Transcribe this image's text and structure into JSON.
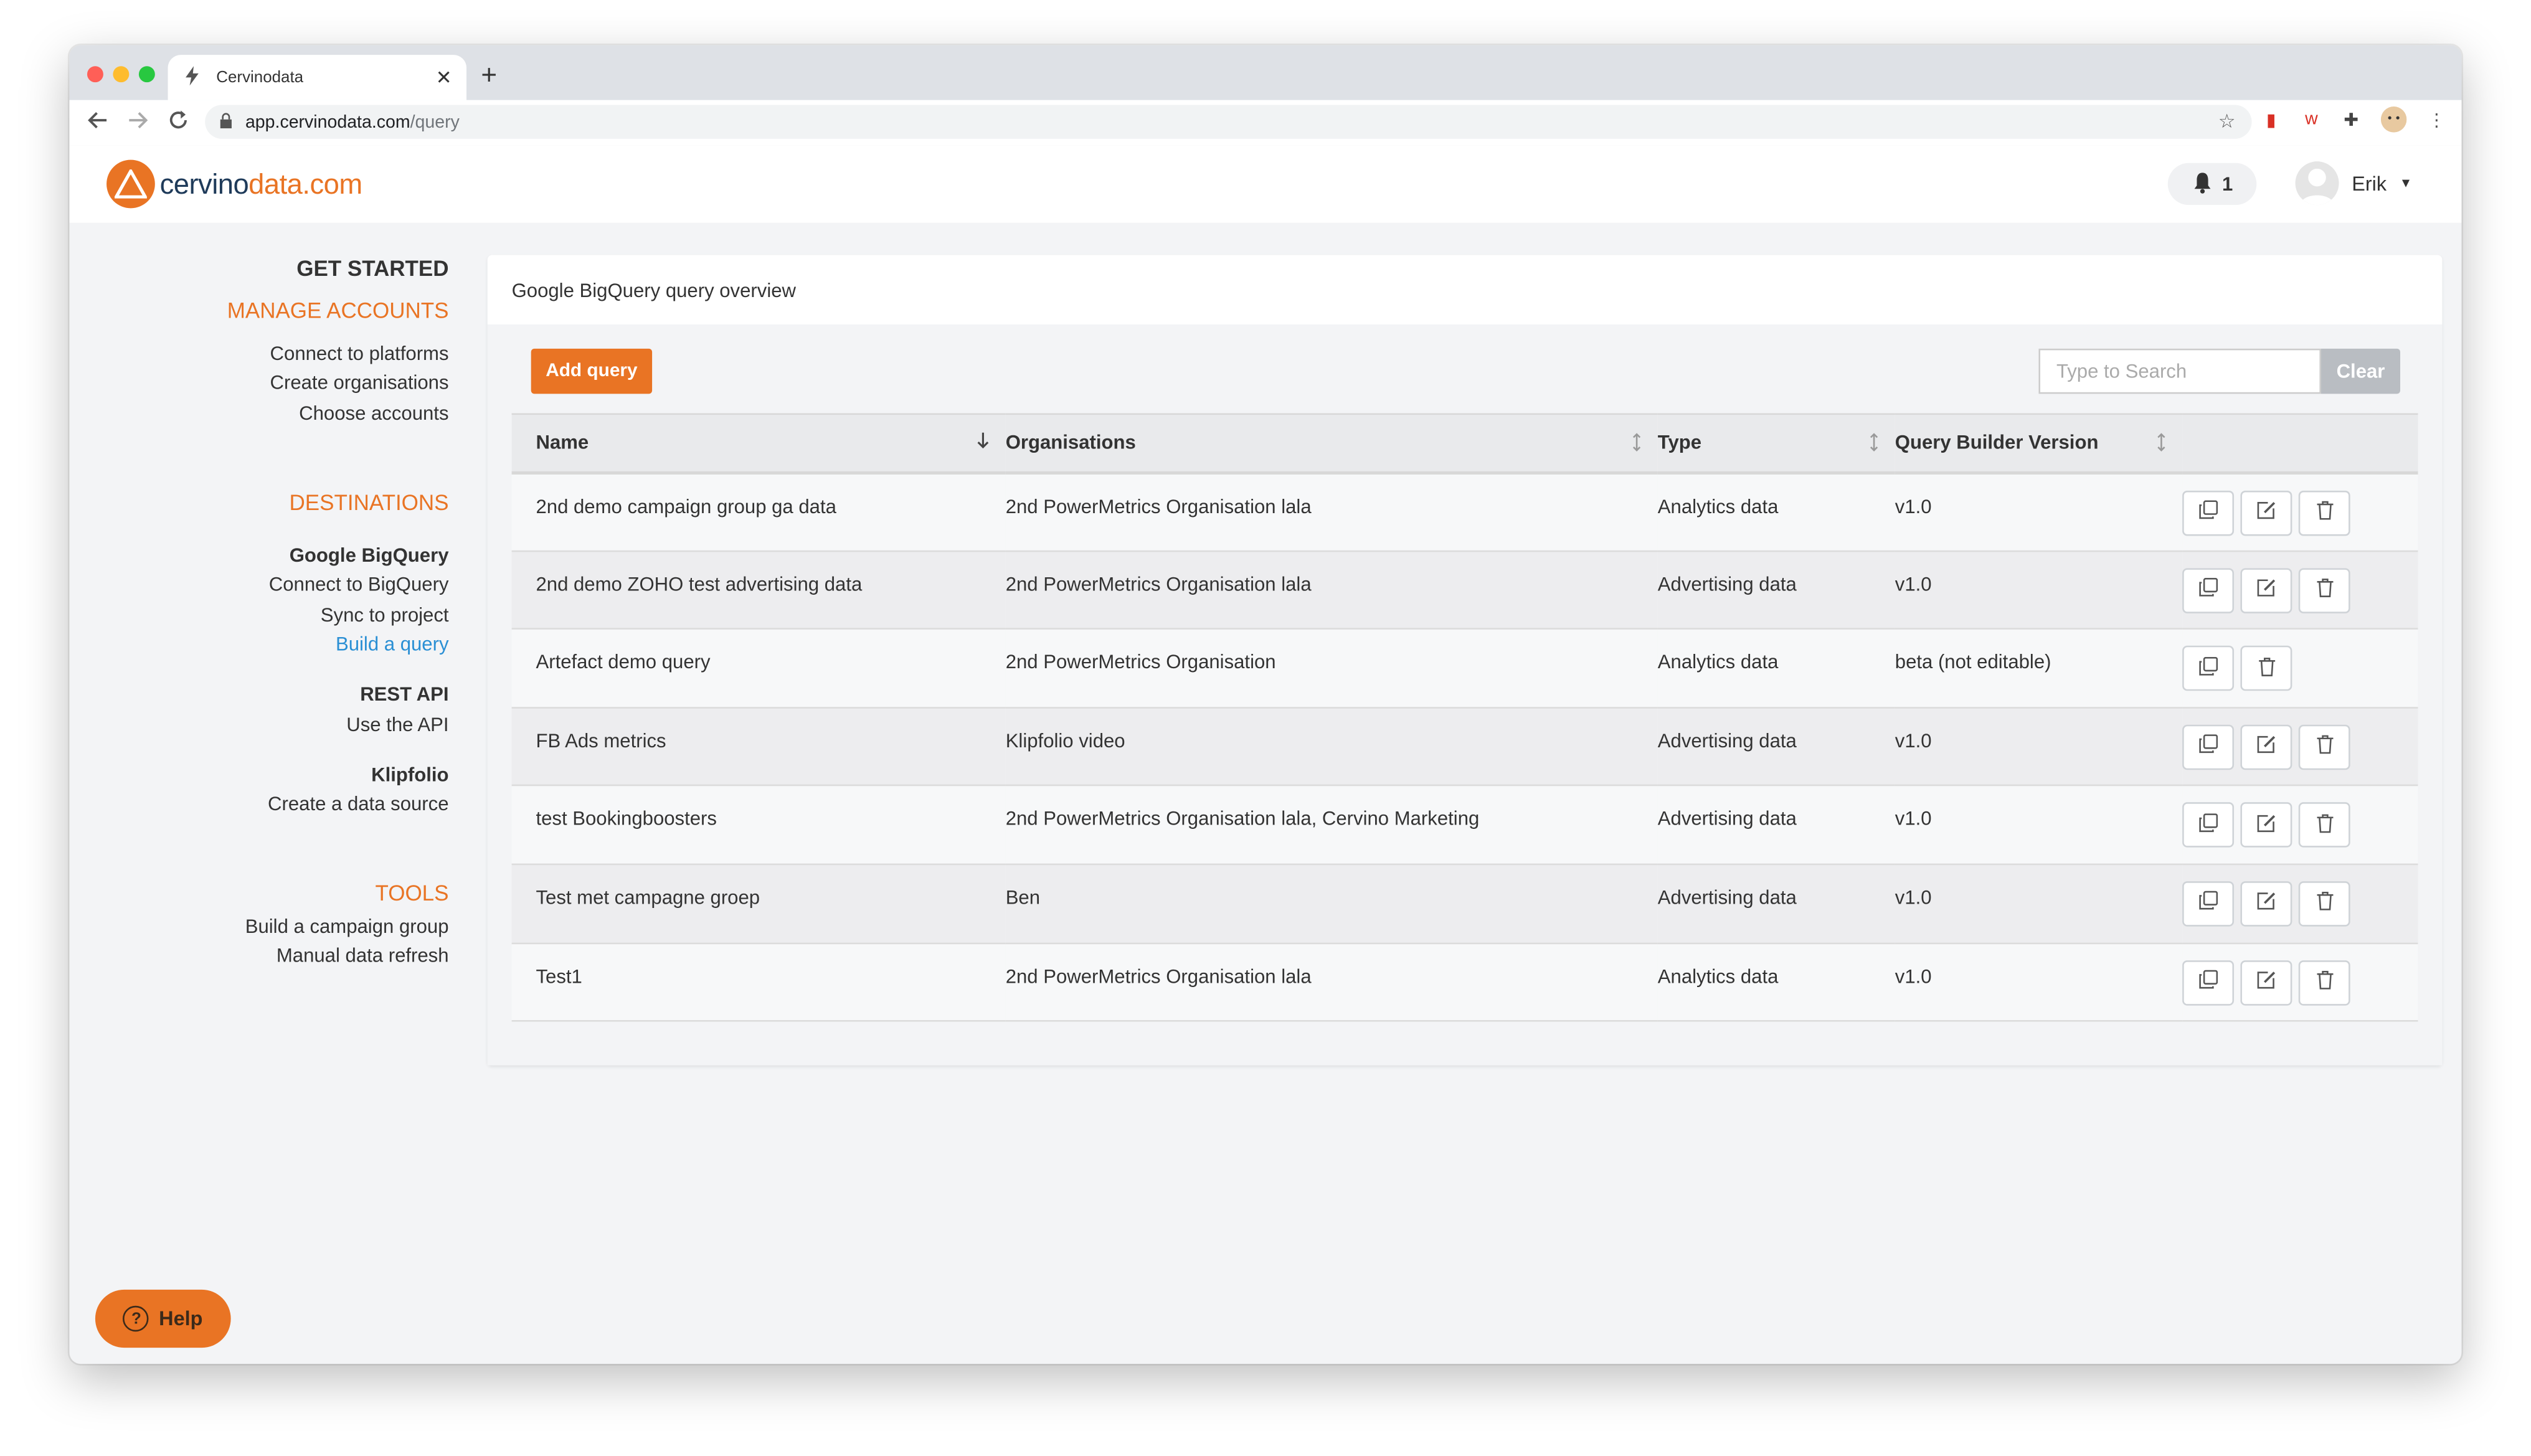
{
  "browser": {
    "tab_title": "Cervinodata",
    "url_host": "app.cervinodata.com",
    "url_path": "/query",
    "new_tab": "+",
    "close_tab": "✕"
  },
  "header": {
    "logo_part1": "cervino",
    "logo_part2": "data.com",
    "notification_count": "1",
    "user_name": "Erik"
  },
  "sidebar": {
    "get_started": "GET STARTED",
    "manage_accounts": "MANAGE ACCOUNTS",
    "connect_platforms": "Connect to platforms",
    "create_organisations": "Create organisations",
    "choose_accounts": "Choose accounts",
    "destinations": "DESTINATIONS",
    "google_bigquery": "Google BigQuery",
    "connect_bigquery": "Connect to BigQuery",
    "sync_project": "Sync to project",
    "build_query": "Build a query",
    "rest_api": "REST API",
    "use_api": "Use the API",
    "klipfolio": "Klipfolio",
    "create_source": "Create a data source",
    "tools": "TOOLS",
    "build_campaign": "Build a campaign group",
    "manual_refresh": "Manual data refresh"
  },
  "main": {
    "title": "Google BigQuery query overview",
    "add_query": "Add query",
    "search_placeholder": "Type to Search",
    "clear": "Clear",
    "columns": [
      "Name",
      "Organisations",
      "Type",
      "Query Builder Version"
    ],
    "rows": [
      {
        "name": "2nd demo campaign group ga data",
        "org": "2nd PowerMetrics Organisation lala",
        "type": "Analytics data",
        "version": "v1.0"
      },
      {
        "name": "2nd demo ZOHO test advertising data",
        "org": "2nd PowerMetrics Organisation lala",
        "type": "Advertising data",
        "version": "v1.0"
      },
      {
        "name": "Artefact demo query",
        "org": "2nd PowerMetrics Organisation",
        "type": "Analytics data",
        "version": "beta (not editable)"
      },
      {
        "name": "FB Ads metrics",
        "org": "Klipfolio video",
        "type": "Advertising data",
        "version": "v1.0"
      },
      {
        "name": "test Bookingboosters",
        "org": "2nd PowerMetrics Organisation lala, Cervino Marketing",
        "type": "Advertising data",
        "version": "v1.0"
      },
      {
        "name": "Test met campagne groep",
        "org": "Ben",
        "type": "Advertising data",
        "version": "v1.0"
      },
      {
        "name": "Test1",
        "org": "2nd PowerMetrics Organisation lala",
        "type": "Analytics data",
        "version": "v1.0"
      }
    ]
  },
  "help": "Help",
  "colors": {
    "accent": "#e97424",
    "link": "#2a8fd4",
    "logo_dark": "#1f3b5a"
  }
}
